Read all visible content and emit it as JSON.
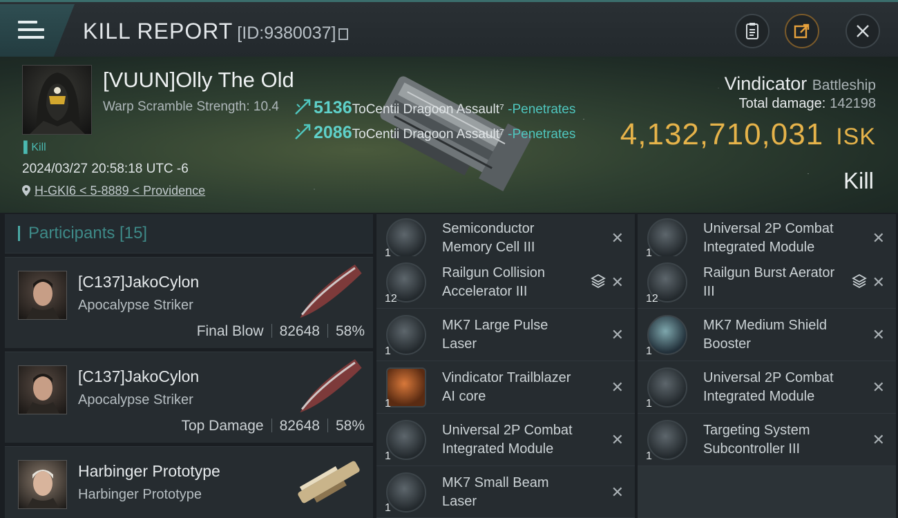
{
  "header": {
    "title": "KILL REPORT",
    "id_text": "[ID:9380037]"
  },
  "victim": {
    "name": "[VUUN]Olly The Old",
    "warp_scramble": "Warp Scramble Strength: 10.4",
    "tag": "Kill",
    "timestamp": "2024/03/27 20:58:18 UTC -6",
    "location": "H-GKI6 < 5-8889 < Providence",
    "ship_name": "Vindicator",
    "ship_class": "Battleship",
    "total_damage_label": "Total damage:",
    "total_damage_value": "142198",
    "isk_value": "4,132,710,031",
    "isk_unit": "ISK",
    "result": "Kill"
  },
  "hits": [
    {
      "damage": "5136",
      "text": "ToCentii Dragoon Assault⁷",
      "effect": "-Penetrates"
    },
    {
      "damage": "2086",
      "text": "ToCentii Dragoon Assault⁷",
      "effect": "-Penetrates"
    }
  ],
  "participants": {
    "header": "Participants [15]",
    "rows": [
      {
        "name": "[C137]JakoCylon",
        "ship": "Apocalypse Striker",
        "role": "Final Blow",
        "damage": "82648",
        "percent": "58%"
      },
      {
        "name": "[C137]JakoCylon",
        "ship": "Apocalypse Striker",
        "role": "Top Damage",
        "damage": "82648",
        "percent": "58%"
      },
      {
        "name": "Harbinger Prototype",
        "ship": "Harbinger Prototype",
        "role": "",
        "damage": "",
        "percent": ""
      }
    ]
  },
  "modules": {
    "col1": [
      {
        "line1": "Semiconductor",
        "line2": "Memory Cell III",
        "qty": "1",
        "icon": "cell-icon"
      },
      {
        "line1": "Railgun Collision",
        "line2": "Accelerator III",
        "qty": "12",
        "icon": "railgun-icon"
      },
      {
        "line1": "MK7 Large Pulse",
        "line2": "Laser",
        "qty": "1",
        "icon": "laser-icon"
      },
      {
        "line1": "Vindicator Trailblazer",
        "line2": "AI core",
        "qty": "1",
        "icon": "ai-core-icon"
      },
      {
        "line1": "Universal 2P Combat",
        "line2": "Integrated Module",
        "qty": "1",
        "icon": "combat-module-icon"
      },
      {
        "line1": "MK7 Small Beam",
        "line2": "Laser",
        "qty": "1",
        "icon": "laser-icon"
      }
    ],
    "col2": [
      {
        "line1": "Universal 2P Combat",
        "line2": "Integrated Module",
        "qty": "1",
        "icon": "combat-module-icon"
      },
      {
        "line1": "Railgun Burst Aerator",
        "line2": "III",
        "qty": "12",
        "icon": "railgun-icon"
      },
      {
        "line1": "MK7 Medium Shield",
        "line2": "Booster",
        "qty": "1",
        "icon": "shield-icon"
      },
      {
        "line1": "Universal 2P Combat",
        "line2": "Integrated Module",
        "qty": "1",
        "icon": "combat-module-icon"
      },
      {
        "line1": "Targeting System",
        "line2": "Subcontroller III",
        "qty": "1",
        "icon": "cell-icon"
      }
    ]
  },
  "colors": {
    "accent": "#4fc6be",
    "isk": "#e6b34a"
  }
}
